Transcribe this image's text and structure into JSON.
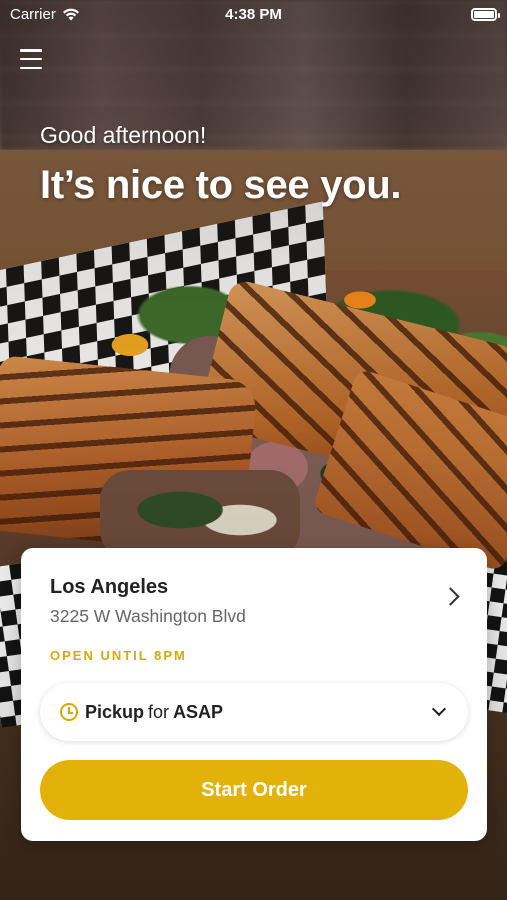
{
  "status_bar": {
    "carrier": "Carrier",
    "time": "4:38 PM",
    "wifi_icon": "wifi-icon",
    "battery_icon": "battery-full-icon"
  },
  "header": {
    "menu_icon": "hamburger-menu-icon",
    "greeting": "Good afternoon!",
    "headline": "It’s nice to see you."
  },
  "location": {
    "name": "Los Angeles",
    "address": "3225 W Washington Blvd",
    "open_status": "OPEN UNTIL 8PM",
    "chevron_icon": "chevron-right-icon"
  },
  "pickup": {
    "mode": "Pickup",
    "connector": "for",
    "when": "ASAP",
    "clock_icon": "clock-icon",
    "dropdown_icon": "chevron-down-icon"
  },
  "actions": {
    "start_order_label": "Start Order"
  },
  "colors": {
    "accent": "#e2b20b",
    "open_status": "#d9a80a"
  }
}
